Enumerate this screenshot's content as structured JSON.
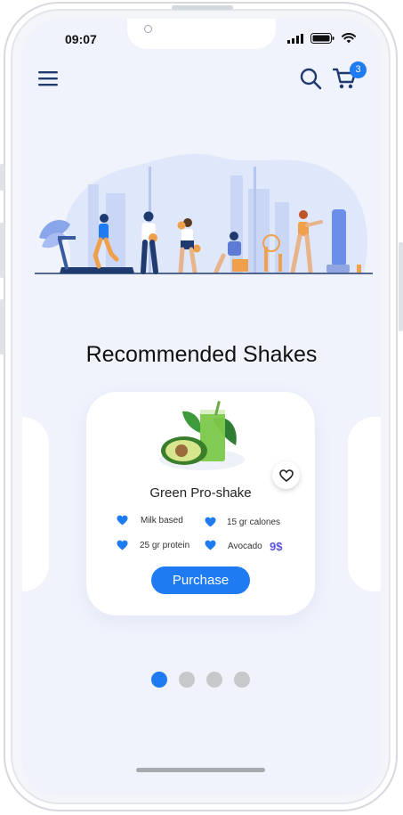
{
  "status_bar": {
    "time": "09:07"
  },
  "app_bar": {
    "cart_count": "3"
  },
  "section_title": "Recommended Shakes",
  "product": {
    "name": "Green Pro-shake",
    "features": [
      {
        "label": "Milk based"
      },
      {
        "label": "15 gr calones"
      },
      {
        "label": "25 gr protein"
      },
      {
        "label": "Avocado"
      }
    ],
    "price": "9$",
    "purchase_label": "Purchase"
  },
  "carousel": {
    "pages": 4,
    "active_index": 0
  },
  "colors": {
    "accent": "#1e7bf2",
    "price": "#5a52e0",
    "screen_bg": "#f0f3fc",
    "hero_navy": "#1f3a6e"
  }
}
